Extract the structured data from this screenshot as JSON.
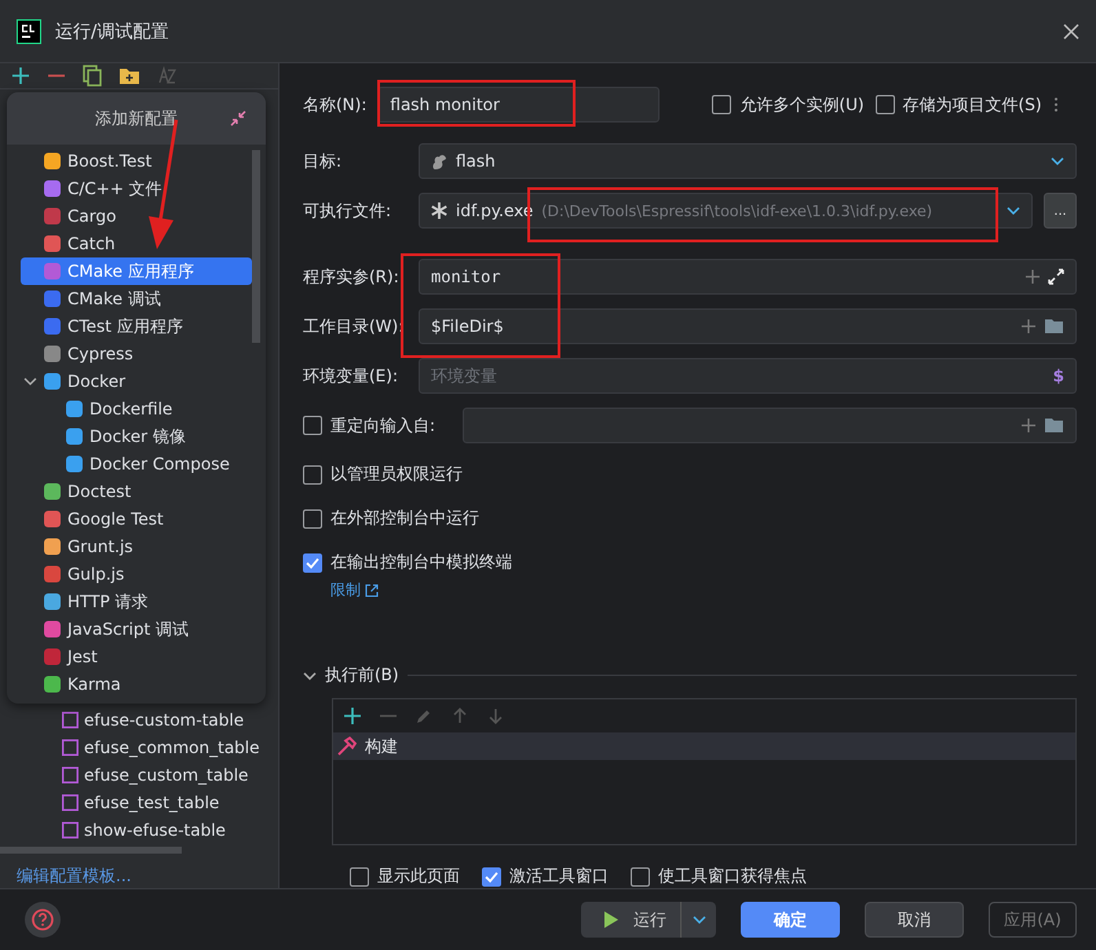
{
  "window": {
    "title": "运行/调试配置"
  },
  "popup": {
    "title": "添加新配置",
    "items": [
      {
        "label": "Boost.Test",
        "kind": "boost",
        "selected": false
      },
      {
        "label": "C/C++ 文件",
        "kind": "cpp",
        "selected": false
      },
      {
        "label": "Cargo",
        "kind": "cargo",
        "selected": false
      },
      {
        "label": "Catch",
        "kind": "flask",
        "selected": false
      },
      {
        "label": "CMake 应用程序",
        "kind": "window",
        "selected": true
      },
      {
        "label": "CMake 调试",
        "kind": "cmake",
        "selected": false
      },
      {
        "label": "CTest 应用程序",
        "kind": "cmake",
        "selected": false
      },
      {
        "label": "Cypress",
        "kind": "cypress",
        "selected": false
      },
      {
        "label": "Docker",
        "kind": "docker",
        "selected": false,
        "expanded": true,
        "children": [
          {
            "label": "Dockerfile",
            "kind": "docker",
            "selected": false
          },
          {
            "label": "Docker 镜像",
            "kind": "docker",
            "selected": false
          },
          {
            "label": "Docker Compose",
            "kind": "docker",
            "selected": false
          }
        ]
      },
      {
        "label": "Doctest",
        "kind": "doctest",
        "selected": false
      },
      {
        "label": "Google Test",
        "kind": "flask",
        "selected": false
      },
      {
        "label": "Grunt.js",
        "kind": "grunt",
        "selected": false
      },
      {
        "label": "Gulp.js",
        "kind": "gulp",
        "selected": false
      },
      {
        "label": "HTTP 请求",
        "kind": "http",
        "selected": false
      },
      {
        "label": "JavaScript 调试",
        "kind": "jsdebug",
        "selected": false
      },
      {
        "label": "Jest",
        "kind": "jest",
        "selected": false
      },
      {
        "label": "Karma",
        "kind": "karma",
        "selected": false
      }
    ]
  },
  "background_list": [
    "efuse-custom-table",
    "efuse_common_table",
    "efuse_custom_table",
    "efuse_test_table",
    "show-efuse-table"
  ],
  "edit_templates_link": "编辑配置模板...",
  "form": {
    "name": {
      "label": "名称(N):",
      "value": "flash monitor"
    },
    "allow_multiple": {
      "label": "允许多个实例(U)",
      "checked": false
    },
    "store_as_file": {
      "label": "存储为项目文件(S)",
      "checked": false
    },
    "target": {
      "label": "目标:",
      "value": "flash"
    },
    "executable": {
      "label": "可执行文件:",
      "value": "idf.py.exe",
      "path": "(D:\\DevTools\\Espressif\\tools\\idf-exe\\1.0.3\\idf.py.exe)",
      "browse": "..."
    },
    "program_args": {
      "label": "程序实参(R):",
      "value": "monitor"
    },
    "working_dir": {
      "label": "工作目录(W):",
      "value": "$FileDir$"
    },
    "env": {
      "label": "环境变量(E):",
      "placeholder": "环境变量",
      "symbol": "$"
    },
    "redirect": {
      "label": "重定向输入自:",
      "checked": false
    },
    "options": [
      {
        "label": "以管理员权限运行",
        "checked": false
      },
      {
        "label": "在外部控制台中运行",
        "checked": false
      },
      {
        "label": "在输出控制台中模拟终端",
        "checked": true
      }
    ],
    "limit_link": "限制",
    "before_launch": {
      "label": "执行前(B)",
      "expanded": true,
      "tasks": [
        {
          "label": "构建",
          "selected": true
        }
      ]
    },
    "launch_options": [
      {
        "label": "显示此页面",
        "checked": false
      },
      {
        "label": "激活工具窗口",
        "checked": true
      },
      {
        "label": "使工具窗口获得焦点",
        "checked": false
      }
    ]
  },
  "footer": {
    "run": "运行",
    "ok": "确定",
    "cancel": "取消",
    "apply": "应用(A)"
  }
}
